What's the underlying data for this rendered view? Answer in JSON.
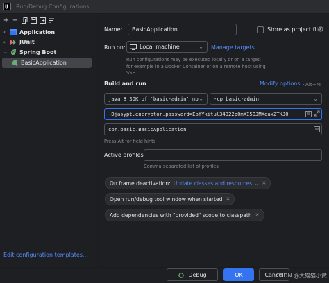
{
  "window": {
    "title": "Run/Debug Configurations",
    "app_icon": "IJ"
  },
  "toolbar": {
    "add": "+",
    "remove": "−",
    "copy": "copy-icon",
    "save": "save-icon",
    "move": "move-icon"
  },
  "tree": {
    "items": [
      {
        "label": "Application",
        "icon": "application-icon",
        "chevron": "›"
      },
      {
        "label": "JUnit",
        "icon": "junit-icon",
        "chevron": "›"
      },
      {
        "label": "Spring Boot",
        "icon": "spring-boot-icon",
        "chevron": "⌄"
      }
    ],
    "selected_child": {
      "label": "BasicApplication"
    }
  },
  "edit_templates_label": "Edit configuration templates...",
  "form": {
    "name_label": "Name:",
    "name_value": "BasicApplication",
    "store_project_label": "Store as project file",
    "run_on_label": "Run on:",
    "run_on_value": "Local machine",
    "manage_targets": "Manage targets...",
    "run_on_hint": "Run configurations may be executed locally or on a target: for example in a Docker Container or on a remote host using SSH.",
    "build_run_label": "Build and run",
    "modify_options": "Modify options",
    "modify_shortcut": "Alt+M",
    "jdk_value": "java 8 SDK of 'basic-admin' mo",
    "classpath_value": "-cp  basic-admin",
    "vm_options": "-Djasypt.encryptor.password=EbfYkitul34322p0mXI5OJMXoaxZTKJ0",
    "main_class": "com.basic.BasicApplication",
    "field_hint": "Press Alt for field hints",
    "active_profiles_label": "Active profiles:",
    "active_profiles_value": "",
    "profiles_hint": "Comma-separated list of profiles",
    "chips": [
      {
        "label": "On frame deactivation:",
        "link": "Update classes and resources",
        "dropdown": "⌄"
      },
      {
        "label": "Open run/debug tool window when started",
        "link": ""
      },
      {
        "label": "Add dependencies with \"provided\" scope to classpath",
        "link": ""
      }
    ]
  },
  "buttons": {
    "debug": "Debug",
    "ok": "OK",
    "cancel": "Cancel"
  },
  "watermark": "CSDN @大猫猫小黄",
  "colors": {
    "accent": "#3574f0",
    "link": "#548af7",
    "spring": "#6aab73",
    "background": "#1e1f22"
  }
}
